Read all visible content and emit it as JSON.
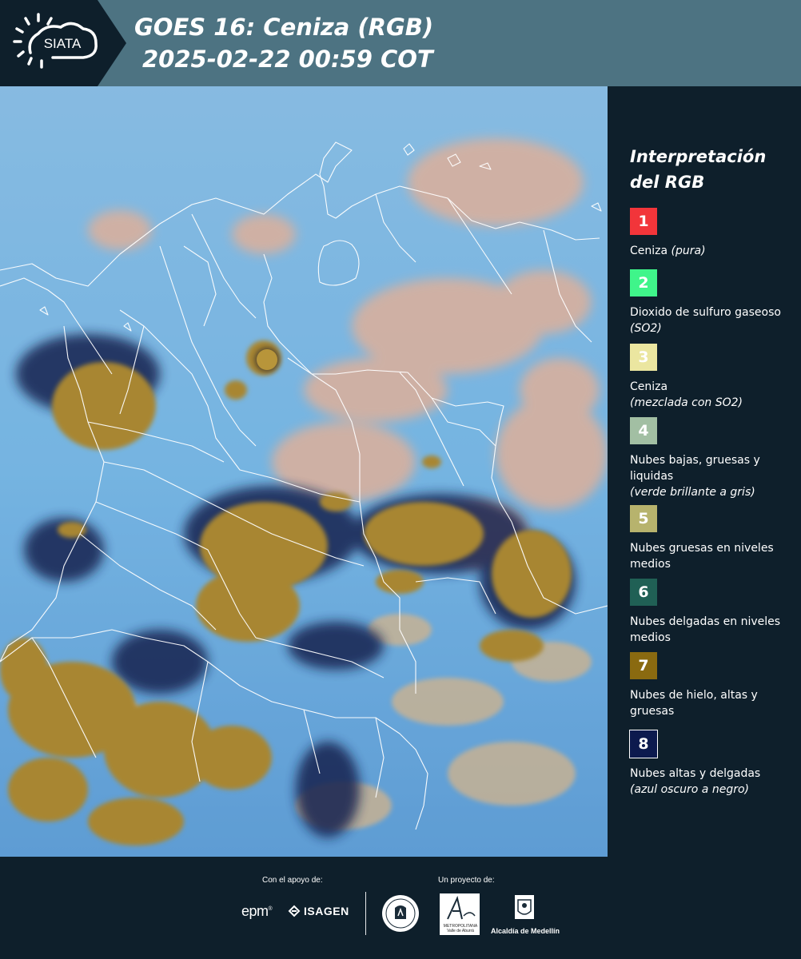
{
  "header": {
    "logo_text": "SIATA",
    "title_line1": "GOES 16: Ceniza (RGB)",
    "title_line2": "2025-02-22 00:59 COT"
  },
  "map": {
    "description_icon": "satellite-rgb-ash-composite",
    "colors": {
      "clear_sky": "#6aaee0",
      "low_cloud": "#d9b09c",
      "ice_cloud": "#a88630",
      "thin_high_cloud": "#16224f",
      "borders": "#ffffff"
    }
  },
  "legend": {
    "title": "Interpretación del RGB",
    "items": [
      {
        "number": "1",
        "color": "#f2353a",
        "text_color": "#ffffff",
        "label": "Ceniza",
        "label_italic": "(pura)"
      },
      {
        "number": "2",
        "color": "#3ff58a",
        "text_color": "#ffffff",
        "label": "Dioxido de sulfuro gaseoso",
        "label_italic": "(SO2)"
      },
      {
        "number": "3",
        "color": "#ebe6a0",
        "text_color": "#ffffff",
        "label": "Ceniza",
        "label_italic": "(mezclada con SO2)"
      },
      {
        "number": "4",
        "color": "#a2bfa3",
        "text_color": "#ffffff",
        "label": "Nubes bajas, gruesas y liquidas",
        "label_italic": "(verde brillante a gris)"
      },
      {
        "number": "5",
        "color": "#b7b36d",
        "text_color": "#ffffff",
        "label": "Nubes gruesas en niveles medios",
        "label_italic": ""
      },
      {
        "number": "6",
        "color": "#206055",
        "text_color": "#ffffff",
        "label": "Nubes delgadas en niveles medios",
        "label_italic": ""
      },
      {
        "number": "7",
        "color": "#8a6a10",
        "text_color": "#ffffff",
        "label": "Nubes de hielo, altas y gruesas",
        "label_italic": ""
      },
      {
        "number": "8",
        "color": "#0c1a4e",
        "text_color": "#ffffff",
        "label": "Nubes altas y delgadas",
        "label_italic": "(azul oscuro a negro)"
      }
    ]
  },
  "footer": {
    "support_label": "Con el apoyo de:",
    "project_label": "Un proyecto de:",
    "sponsors": [
      "epm",
      "ISAGEN"
    ],
    "partners": [
      "Área Metropolitana",
      "Alcaldía de Medellín"
    ],
    "area_caption": "METROPOLITANA Valle de Aburrá",
    "alcaldia_label": "Alcaldía de Medellín"
  }
}
